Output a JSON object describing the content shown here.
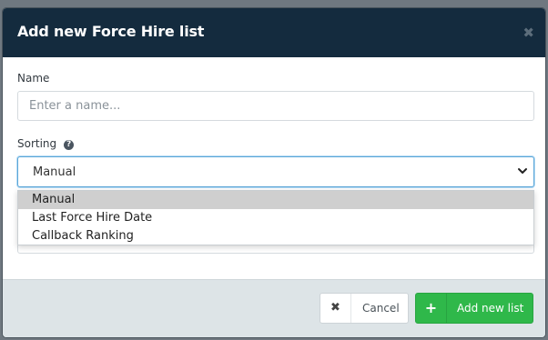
{
  "modal": {
    "title": "Add new Force Hire list",
    "close_icon": "close-icon"
  },
  "form": {
    "name_label": "Name",
    "name_placeholder": "Enter a name...",
    "name_value": "",
    "sorting_label": "Sorting",
    "sorting_help_icon": "question-circle-icon",
    "sorting_value": "Manual",
    "sorting_options": [
      "Manual",
      "Last Force Hire Date",
      "Callback Ranking"
    ]
  },
  "footer": {
    "cancel_label": "Cancel",
    "cancel_icon": "close-icon",
    "add_label": "Add new list",
    "add_icon": "plus-icon"
  },
  "colors": {
    "header_bg": "#142b3e",
    "footer_bg": "#dde4e7",
    "primary_green": "#2fb84a",
    "focus_border": "#5aa6d8"
  }
}
